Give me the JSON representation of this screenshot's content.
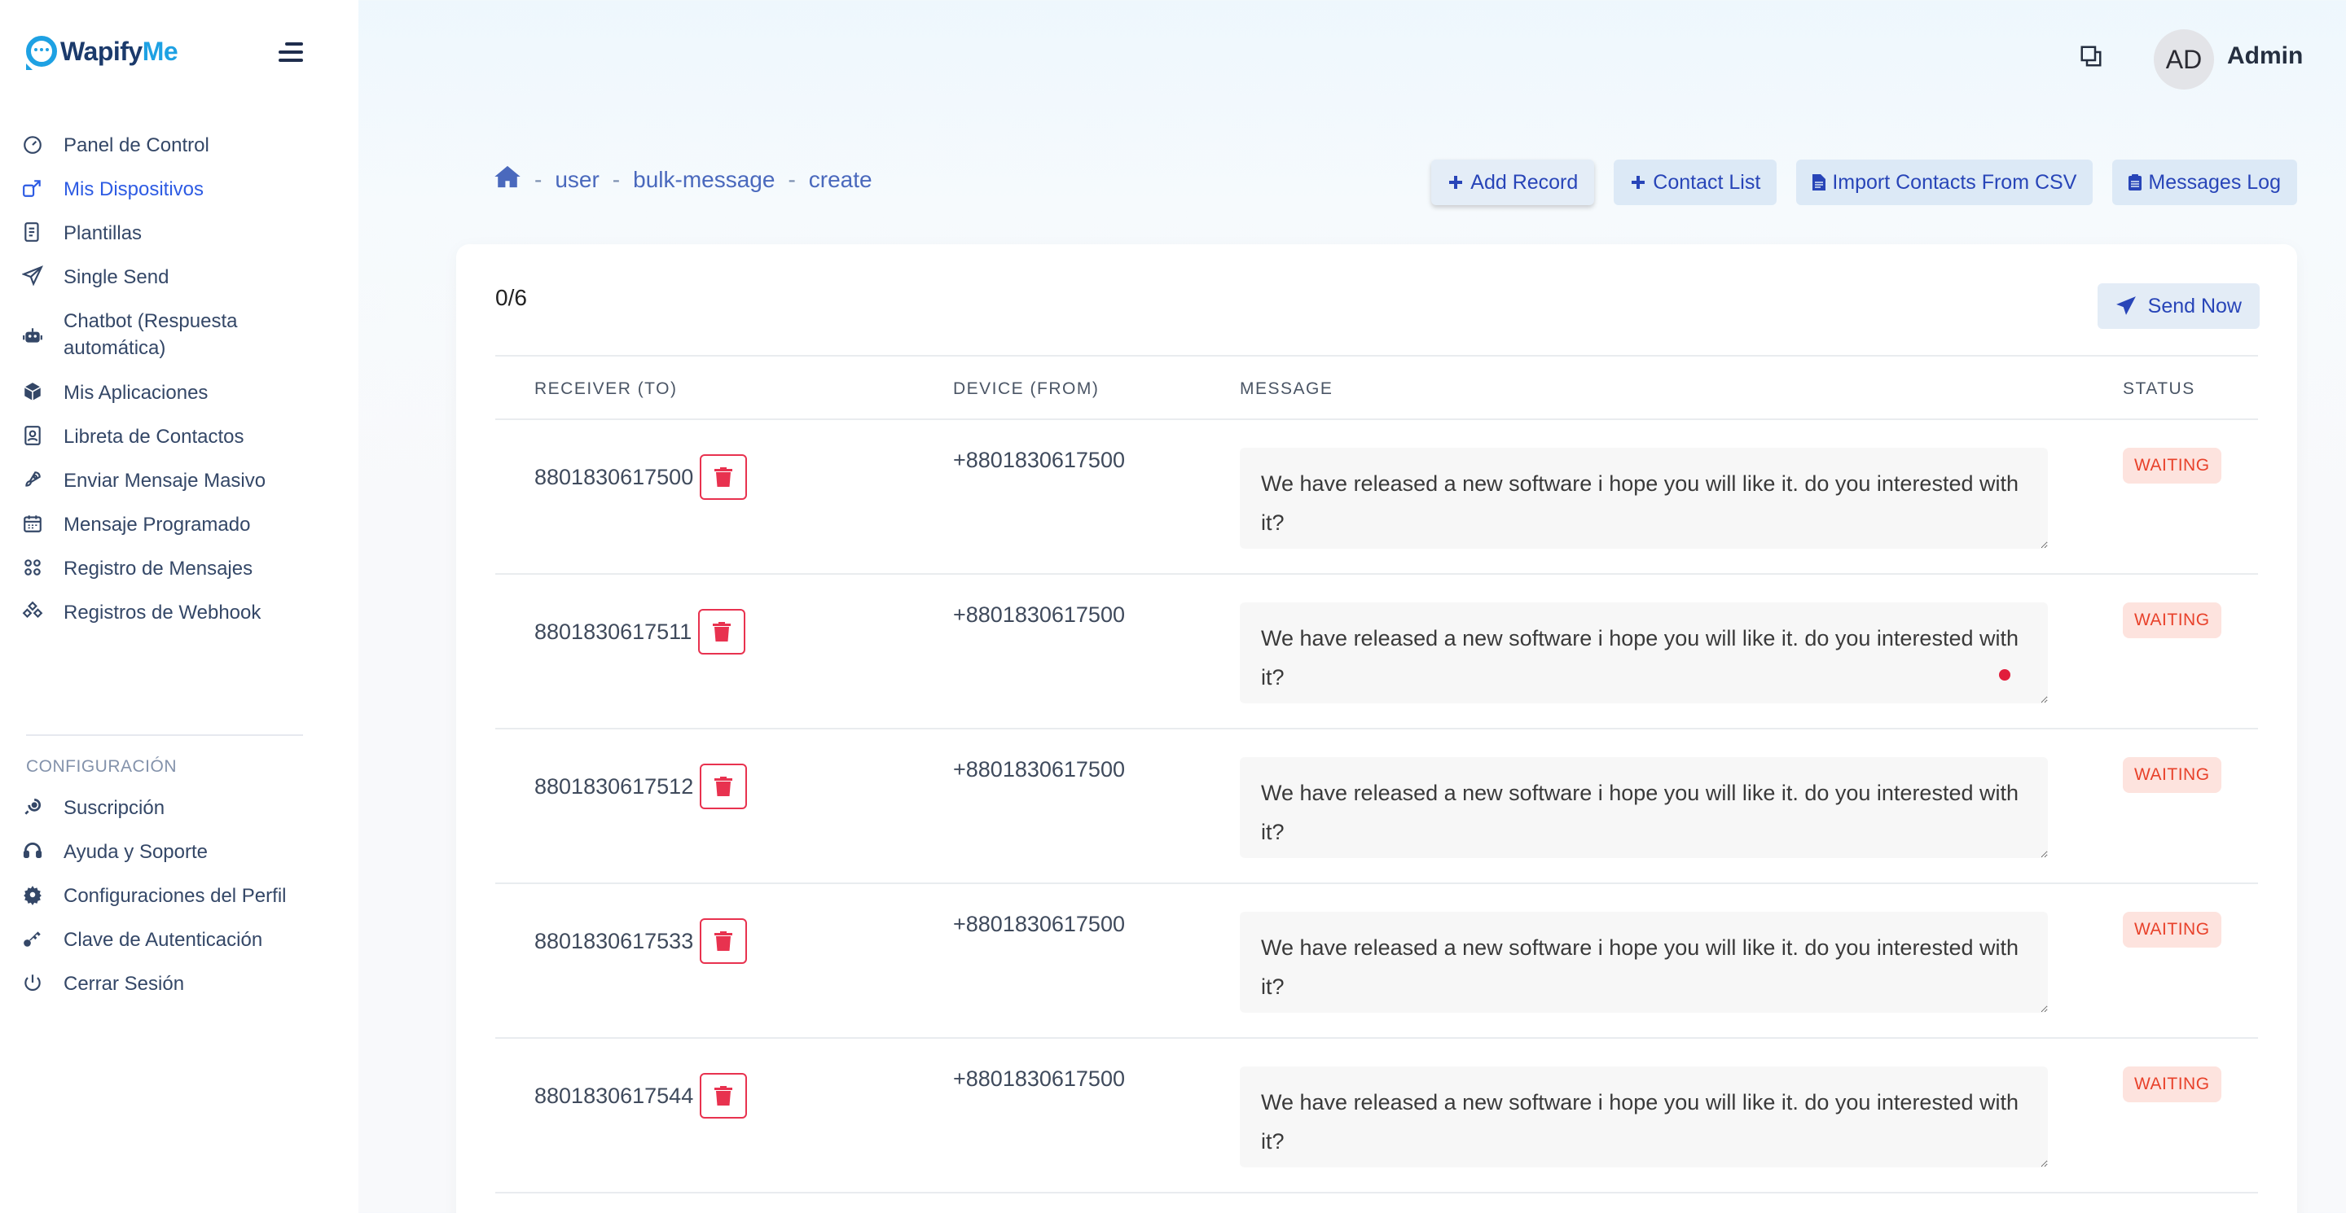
{
  "brand": {
    "part1": "Wapify",
    "part2": "Me"
  },
  "sidebar": {
    "items": [
      {
        "label": "Panel de Control",
        "icon": "gauge-icon"
      },
      {
        "label": "Mis Dispositivos",
        "icon": "devices-icon",
        "active": true
      },
      {
        "label": "Plantillas",
        "icon": "template-icon"
      },
      {
        "label": "Single Send",
        "icon": "paper-plane-icon"
      },
      {
        "label": "Chatbot (Respuesta automática)",
        "icon": "robot-icon"
      },
      {
        "label": "Mis Aplicaciones",
        "icon": "cube-icon"
      },
      {
        "label": "Libreta de Contactos",
        "icon": "contact-book-icon"
      },
      {
        "label": "Enviar Mensaje Masivo",
        "icon": "rocket-icon"
      },
      {
        "label": "Mensaje Programado",
        "icon": "calendar-icon"
      },
      {
        "label": "Registro de Mensajes",
        "icon": "log-icon"
      },
      {
        "label": "Registros de Webhook",
        "icon": "webhook-icon"
      }
    ],
    "section_title": "CONFIGURACIÓN",
    "config_items": [
      {
        "label": "Suscripción",
        "icon": "subscription-icon"
      },
      {
        "label": "Ayuda y Soporte",
        "icon": "headset-icon"
      },
      {
        "label": "Configuraciones del Perfil",
        "icon": "gear-icon"
      },
      {
        "label": "Clave de Autenticación",
        "icon": "key-icon"
      },
      {
        "label": "Cerrar Sesión",
        "icon": "power-icon"
      }
    ]
  },
  "header": {
    "avatar_initials": "AD",
    "user_name": "Admin"
  },
  "breadcrumb": [
    "user",
    "bulk-message",
    "create"
  ],
  "actions": {
    "add_record": "Add Record",
    "contact_list": "Contact List",
    "import_csv": "Import Contacts From CSV",
    "messages_log": "Messages Log"
  },
  "card": {
    "counter": "0/6",
    "send_now": "Send Now"
  },
  "table": {
    "headers": {
      "receiver": "RECEIVER (TO)",
      "device": "DEVICE (FROM)",
      "message": "MESSAGE",
      "status": "STATUS"
    },
    "rows": [
      {
        "receiver": "8801830617500",
        "device": "+8801830617500",
        "message": "We have released a new software i hope you will like it. do you interested with it?",
        "status": "WAITING"
      },
      {
        "receiver": "8801830617511",
        "device": "+8801830617500",
        "message": "We have released a new software i hope you will like it. do you interested with it?",
        "status": "WAITING"
      },
      {
        "receiver": "8801830617512",
        "device": "+8801830617500",
        "message": "We have released a new software i hope you will like it. do you interested with it?",
        "status": "WAITING"
      },
      {
        "receiver": "8801830617533",
        "device": "+8801830617500",
        "message": "We have released a new software i hope you will like it. do you interested with it?",
        "status": "WAITING"
      },
      {
        "receiver": "8801830617544",
        "device": "+8801830617500",
        "message": "We have released a new software i hope you will like it. do you interested with it?",
        "status": "WAITING"
      }
    ]
  }
}
